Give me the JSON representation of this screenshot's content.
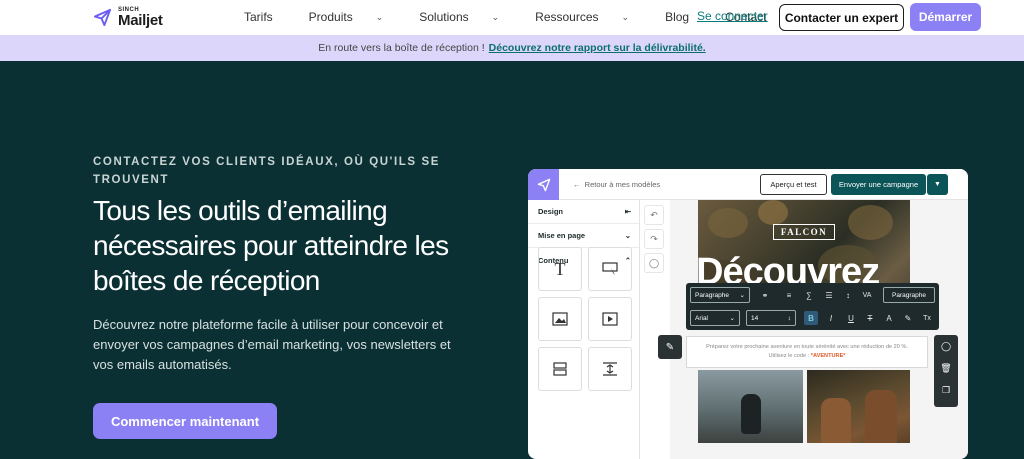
{
  "nav": {
    "brand_small": "SINCH",
    "brand_name": "Mailjet",
    "menu": [
      {
        "label": "Tarifs",
        "dropdown": false
      },
      {
        "label": "Produits",
        "dropdown": true
      },
      {
        "label": "Solutions",
        "dropdown": true
      },
      {
        "label": "Ressources",
        "dropdown": true
      },
      {
        "label": "Blog",
        "dropdown": false
      },
      {
        "label": "Contact",
        "dropdown": true
      }
    ],
    "login": "Se connecter",
    "expert": "Contacter un expert",
    "start": "Démarrer"
  },
  "banner": {
    "text": "En route vers la boîte de réception !",
    "link": "Découvrez notre rapport sur la délivrabilité."
  },
  "hero": {
    "eyebrow": "CONTACTEZ VOS CLIENTS IDÉAUX, OÙ QU'ILS SE TROUVENT",
    "title": "Tous les outils d’emailing nécessaires pour atteindre les boîtes de réception",
    "lead": "Découvrez notre plateforme facile à utiliser pour concevoir et envoyer vos campagnes d’email marketing, vos newsletters et vos emails automatisés.",
    "cta": "Commencer maintenant"
  },
  "editor": {
    "back": "Retour à mes modèles",
    "preview": "Aperçu et test",
    "send": "Envoyer une campagne",
    "side": [
      {
        "label": "Design",
        "icon": "collapse-left-icon"
      },
      {
        "label": "Mise en page",
        "icon": "chevron-down-icon"
      },
      {
        "label": "Contenu",
        "icon": "chevron-up-icon"
      }
    ],
    "brand_badge": "FALCON",
    "headline": "Découvrez",
    "toolbar": {
      "style_select": "Paragraphe",
      "style_select_2": "Paragraphe",
      "font": "Arial",
      "size": "14"
    },
    "text_block": {
      "line1": "Préparez votre prochaine aventure en toute sérénité avec une réduction de 20 %.",
      "line2_prefix": "Utilisez le code :",
      "code": "*AVENTURE*"
    }
  },
  "colors": {
    "accent": "#8b80f4",
    "hero_bg": "#0b3033",
    "banner_bg": "#ddd6fb",
    "link": "#0a7b7a",
    "send_btn": "#0b5458"
  }
}
